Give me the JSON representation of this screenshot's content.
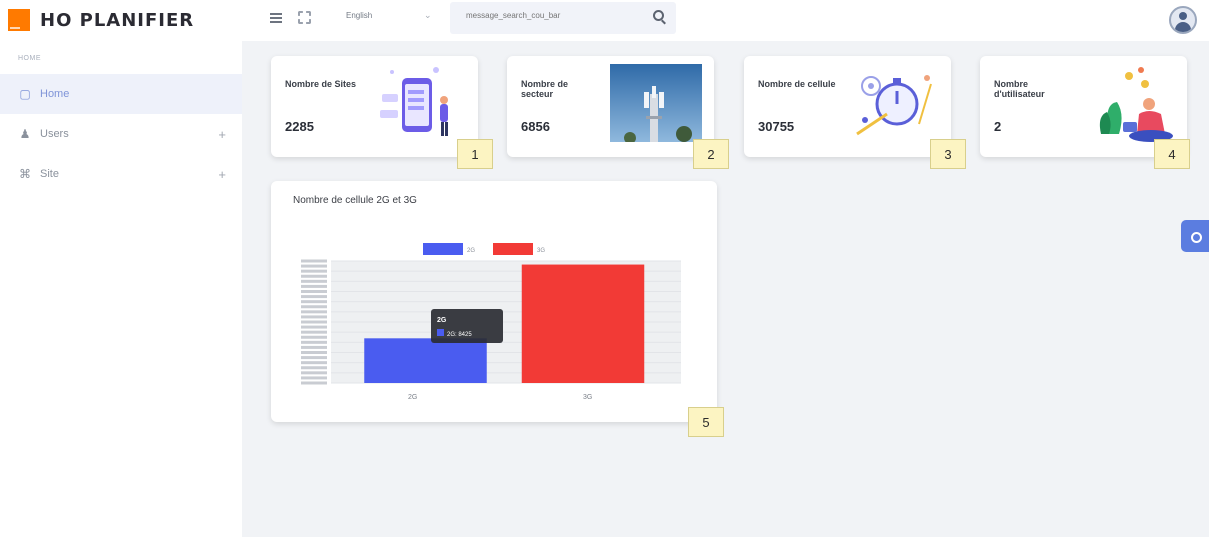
{
  "brand": {
    "name": "HO PLANIFIER"
  },
  "sidebar": {
    "caption": "HOME",
    "items": [
      {
        "label": "Home",
        "icon": "monitor-icon",
        "active": true
      },
      {
        "label": "Users",
        "icon": "user-icon",
        "expand": "+"
      },
      {
        "label": "Site",
        "icon": "command-icon",
        "expand": "+"
      }
    ]
  },
  "topbar": {
    "language": "English",
    "search_placeholder": "message_search_cou_bar"
  },
  "stats": [
    {
      "label": "Nombre de Sites",
      "value": "2285",
      "callout": "1"
    },
    {
      "label": "Nombre de secteur",
      "value": "6856",
      "callout": "2"
    },
    {
      "label": "Nombre de cellule",
      "value": "30755",
      "callout": "3"
    },
    {
      "label": "Nombre d'utilisateur",
      "value": "2",
      "callout": "4"
    }
  ],
  "chart_card": {
    "title": "Nombre de cellule 2G et 3G",
    "callout": "5"
  },
  "chart_data": {
    "type": "bar",
    "categories": [
      "2G",
      "3G"
    ],
    "series": [
      {
        "name": "2G",
        "color": "#4a5cf0",
        "values": [
          8425,
          null
        ]
      },
      {
        "name": "3G",
        "color": "#f23a36",
        "values": [
          null,
          22330
        ]
      }
    ],
    "ylim": [
      0,
      23000
    ],
    "grid": true,
    "legend": "top",
    "tooltip": {
      "title": "2G",
      "text": "2G: 8425"
    }
  },
  "colors": {
    "accent": "#7f94d8",
    "brand_orange": "#ff7a00",
    "callout_bg": "#fcf4c2"
  }
}
